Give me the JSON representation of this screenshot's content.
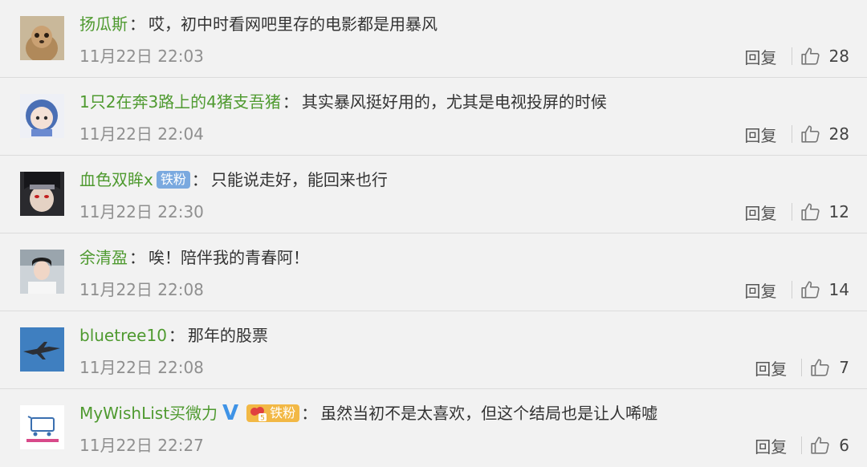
{
  "colors": {
    "username": "#4f9a30",
    "background": "#f2f2f2",
    "time": "#8f8f8f",
    "iron_badge": "#7aa9df",
    "gold_badge": "#f2b845",
    "verified_v": "#3f93e6"
  },
  "icons": {
    "like": "thumbs-up-outline-icon",
    "verified": "verified-v-icon"
  },
  "separator": "：",
  "comments": [
    {
      "username": "扬瓜斯",
      "text": "哎，初中时看网吧里存的电影都是用暴风",
      "time": "11月22日 22:03",
      "reply": "回复",
      "likes": "28"
    },
    {
      "username": "1只2在奔3路上的4猪支吾猪",
      "text": "其实暴风挺好用的，尤其是电视投屏的时候",
      "time": "11月22日 22:04",
      "reply": "回复",
      "likes": "28"
    },
    {
      "username": "血色双眸x",
      "badge": "铁粉",
      "text": "只能说走好，能回来也行",
      "time": "11月22日 22:30",
      "reply": "回复",
      "likes": "12"
    },
    {
      "username": "余清盈",
      "text": "唉！陪伴我的青春阿！",
      "time": "11月22日 22:08",
      "reply": "回复",
      "likes": "14"
    },
    {
      "username": "bluetree10",
      "text": "那年的股票",
      "time": "11月22日 22:08",
      "reply": "回复",
      "likes": "7"
    },
    {
      "username": "MyWishList买微力",
      "badge_level": "5",
      "badge": "铁粉",
      "text": "虽然当初不是太喜欢，但这个结局也是让人唏嘘",
      "time": "11月22日 22:27",
      "reply": "回复",
      "likes": "6"
    }
  ]
}
